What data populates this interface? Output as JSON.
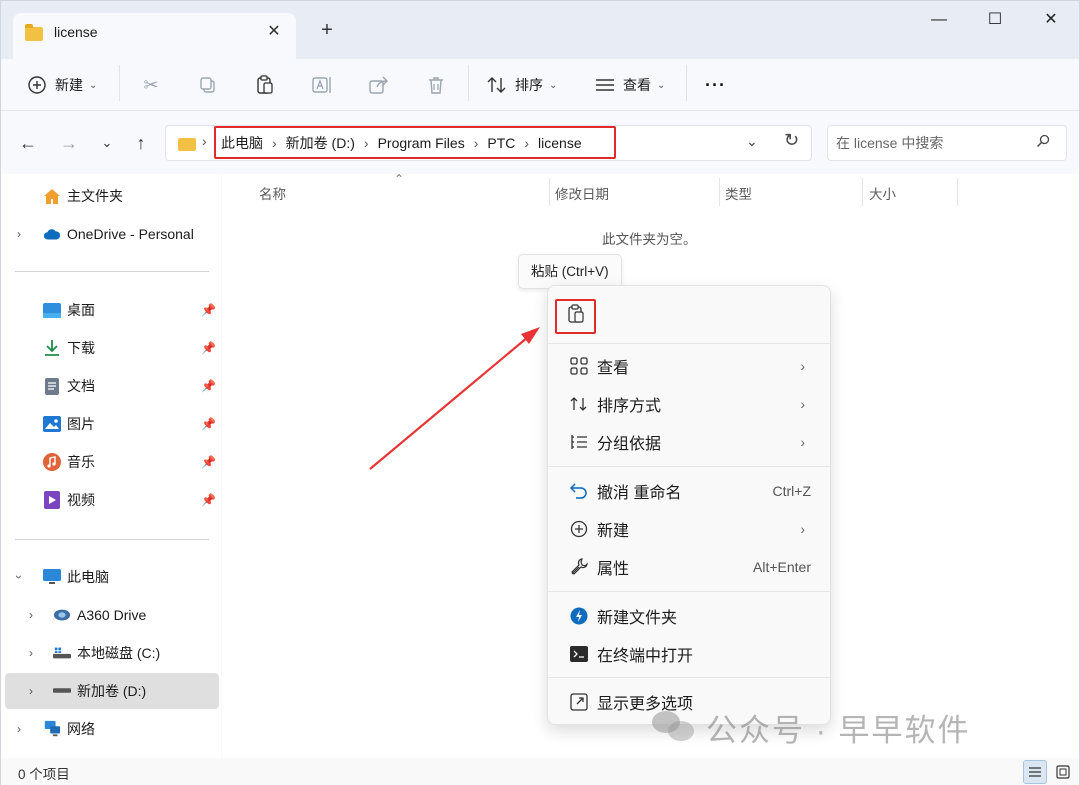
{
  "window": {
    "tab_title": "license",
    "tab_close": "✕",
    "new_tab": "+",
    "minimize": "—",
    "maximize": "☐",
    "close": "✕"
  },
  "toolbar": {
    "new_label": "新建",
    "sort_label": "排序",
    "view_label": "查看",
    "more_label": "···"
  },
  "address_bar": {
    "crumbs": [
      "此电脑",
      "新加卷 (D:)",
      "Program Files",
      "PTC",
      "license"
    ],
    "separator": "›"
  },
  "search": {
    "placeholder": "在 license 中搜索"
  },
  "sidebar": {
    "home": "主文件夹",
    "onedrive": "OneDrive - Personal",
    "quick_access": [
      {
        "label": "桌面",
        "icon": "desktop-icon"
      },
      {
        "label": "下载",
        "icon": "download-icon"
      },
      {
        "label": "文档",
        "icon": "document-icon"
      },
      {
        "label": "图片",
        "icon": "picture-icon"
      },
      {
        "label": "音乐",
        "icon": "music-icon"
      },
      {
        "label": "视频",
        "icon": "video-icon"
      }
    ],
    "this_pc": "此电脑",
    "drives": [
      {
        "label": "A360 Drive",
        "icon": "a360-drive-icon",
        "selected": false
      },
      {
        "label": "本地磁盘 (C:)",
        "icon": "local-disk-icon",
        "selected": false
      },
      {
        "label": "新加卷 (D:)",
        "icon": "drive-icon",
        "selected": true
      }
    ],
    "network": "网络"
  },
  "columns": {
    "name": "名称",
    "modified": "修改日期",
    "type": "类型",
    "size": "大小"
  },
  "content": {
    "empty_message": "此文件夹为空。"
  },
  "tooltip": {
    "text": "粘贴 (Ctrl+V)"
  },
  "context_menu": {
    "items": [
      {
        "label": "查看",
        "icon": "grid-icon",
        "shortcut": "",
        "submenu": true
      },
      {
        "label": "排序方式",
        "icon": "sort-icon",
        "shortcut": "",
        "submenu": true
      },
      {
        "label": "分组依据",
        "icon": "group-icon",
        "shortcut": "",
        "submenu": true
      },
      {
        "label": "撤消 重命名",
        "icon": "undo-icon",
        "shortcut": "Ctrl+Z",
        "submenu": false
      },
      {
        "label": "新建",
        "icon": "new-icon",
        "shortcut": "",
        "submenu": true
      },
      {
        "label": "属性",
        "icon": "wrench-icon",
        "shortcut": "Alt+Enter",
        "submenu": false
      },
      {
        "label": "新建文件夹",
        "icon": "new-folder-icon",
        "shortcut": "",
        "submenu": false
      },
      {
        "label": "在终端中打开",
        "icon": "terminal-icon",
        "shortcut": "",
        "submenu": false
      },
      {
        "label": "显示更多选项",
        "icon": "more-options-icon",
        "shortcut": "",
        "submenu": false
      }
    ]
  },
  "status_bar": {
    "item_count": "0 个项目"
  },
  "watermark": {
    "text": "公众号 · 早早软件"
  },
  "colors": {
    "highlight_red": "#e02b2b",
    "accent_blue": "#0067c0",
    "folder_yellow": "#f2c144"
  }
}
